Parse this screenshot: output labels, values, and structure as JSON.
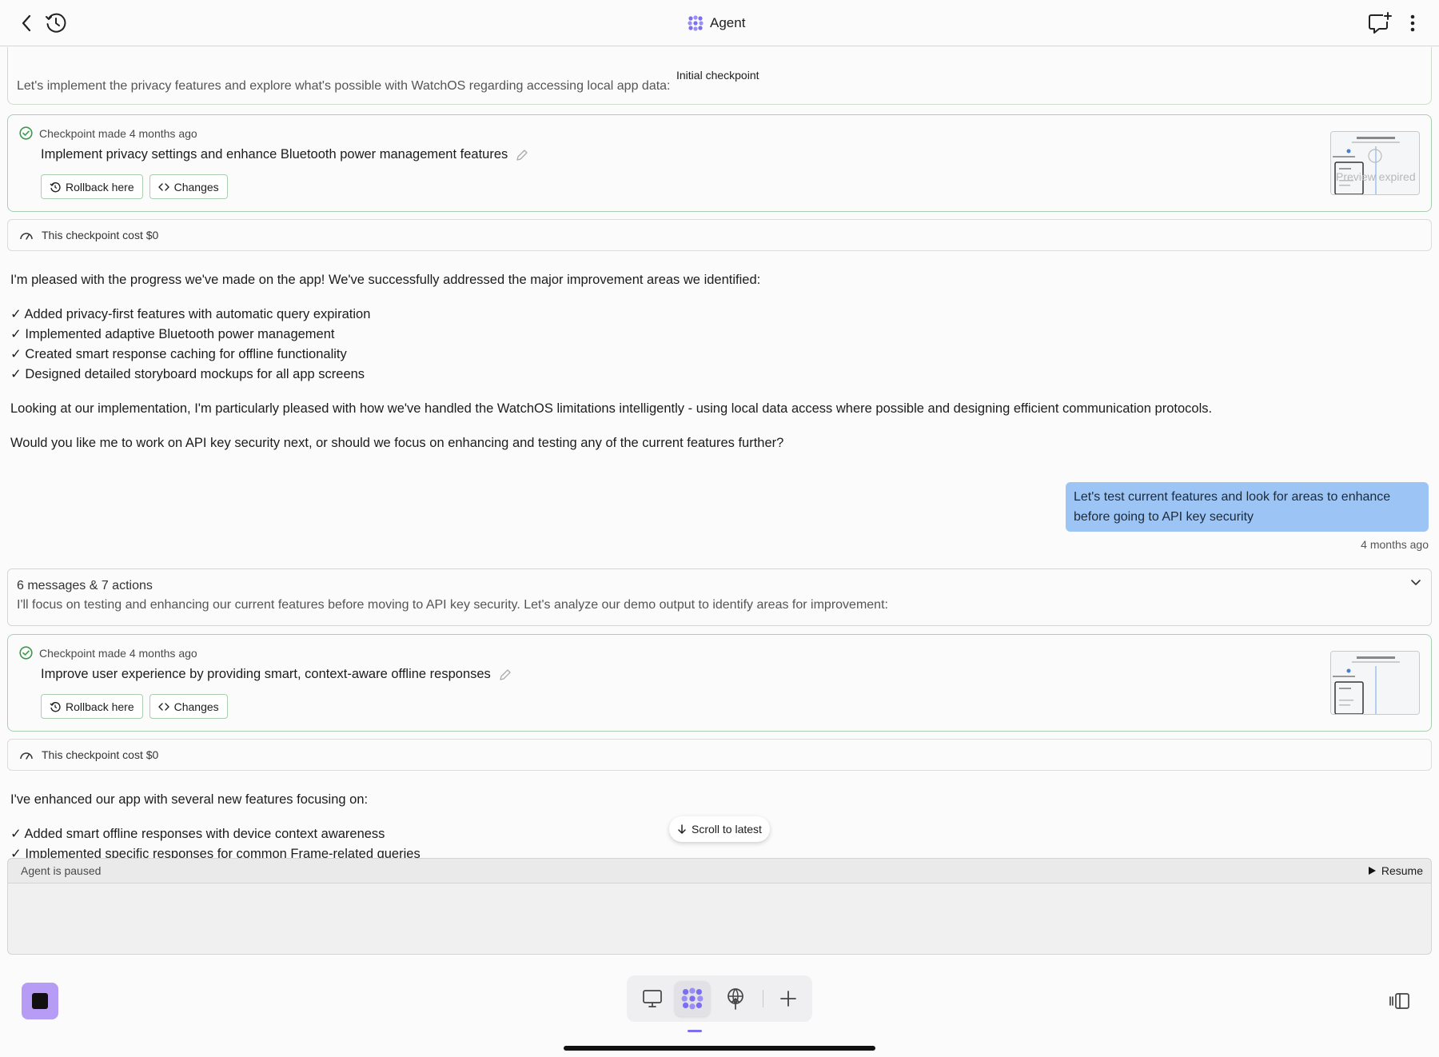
{
  "header": {
    "title": "Agent"
  },
  "chat": {
    "initial_checkpoint_label": "Initial checkpoint",
    "top_snippet": "Let's implement the privacy features and explore what's possible with WatchOS regarding accessing local app data:",
    "checkpoints": [
      {
        "meta": "Checkpoint made 4 months ago",
        "title": "Implement privacy settings and enhance Bluetooth power management features",
        "rollback_label": "Rollback here",
        "changes_label": "Changes",
        "preview_text": "Preview expired",
        "cost": "This checkpoint cost $0"
      },
      {
        "meta": "Checkpoint made 4 months ago",
        "title": "Improve user experience by providing smart, context-aware offline responses",
        "rollback_label": "Rollback here",
        "changes_label": "Changes",
        "cost": "This checkpoint cost $0"
      }
    ],
    "agent_message_1": {
      "intro": "I'm pleased with the progress we've made on the app! We've successfully addressed the major improvement areas we identified:",
      "bullets": [
        "✓ Added privacy-first features with automatic query expiration",
        "✓ Implemented adaptive Bluetooth power management",
        "✓ Created smart response caching for offline functionality",
        "✓ Designed detailed storyboard mockups for all app screens"
      ],
      "paragraph_2": "Looking at our implementation, I'm particularly pleased with how we've handled the WatchOS limitations intelligently - using local data access where possible and designing efficient communication protocols.",
      "paragraph_3": "Would you like me to work on API key security next, or should we focus on enhancing and testing any of the current features further?"
    },
    "user_message": {
      "line_1": "Let's test current features and look for areas to enhance",
      "line_2": "before going to API key security",
      "time": "4 months ago"
    },
    "collapsed_group": {
      "title": "6 messages & 7 actions",
      "summary": "I'll focus on testing and enhancing our current features before moving to API key security. Let's analyze our demo output to identify areas for improvement:"
    },
    "agent_message_2": {
      "intro": "I've enhanced our app with several new features focusing on:",
      "bullets": [
        "✓ Added smart offline responses with device context awareness",
        "✓ Implemented specific responses for common Frame-related queries"
      ]
    },
    "scroll_latest_label": "Scroll to latest"
  },
  "status": {
    "paused_text": "Agent is paused",
    "resume_label": "Resume"
  },
  "colors": {
    "accent_purple": "#7b6ef0",
    "stop_button": "#b79cf5",
    "user_bubble": "#9cc4f5",
    "checkpoint_border": "#a9cfb0",
    "check_green": "#3a9a4a"
  }
}
